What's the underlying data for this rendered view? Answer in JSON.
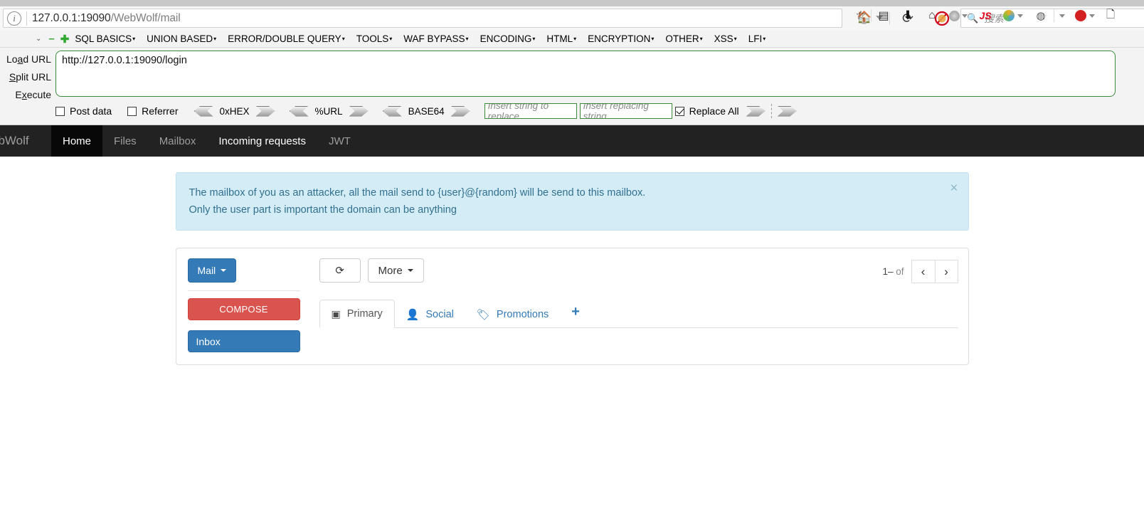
{
  "browser": {
    "url_main": "127.0.0.1:19090",
    "url_path": "/WebWolf/mail",
    "search_placeholder": "搜索",
    "icons": {
      "info": "info-icon",
      "home": "home-icon",
      "reload": "reload-icon",
      "noscript": "noscript-icon",
      "search": "search-icon",
      "bookmark": "star-icon",
      "library": "library-icon",
      "downloads": "download-icon",
      "home2": "home-icon",
      "account": "account-icon",
      "js": "JS",
      "sync": "sync-icon",
      "palette": "palette-icon",
      "extension": "extension-icon",
      "pocket": "page-icon"
    }
  },
  "hackbar": {
    "menu_items": [
      {
        "label": "SQL BASICS",
        "caret": "▾"
      },
      {
        "label": "UNION BASED",
        "caret": "▾"
      },
      {
        "label": "ERROR/DOUBLE QUERY",
        "caret": "▾"
      },
      {
        "label": "TOOLS",
        "caret": "▾"
      },
      {
        "label": "WAF BYPASS",
        "caret": "▾"
      },
      {
        "label": "ENCODING",
        "caret": "▾"
      },
      {
        "label": "HTML",
        "caret": "▾"
      },
      {
        "label": "ENCRYPTION",
        "caret": "▾"
      },
      {
        "label": "OTHER",
        "caret": "▾"
      },
      {
        "label": "XSS",
        "caret": "▾"
      },
      {
        "label": "LFI",
        "caret": "▾"
      }
    ],
    "minus_label": "–",
    "plus_label": "✚",
    "actions": [
      {
        "pre": "Lo",
        "key": "a",
        "post": "d URL"
      },
      {
        "pre": "",
        "key": "S",
        "post": "plit URL"
      },
      {
        "pre": "E",
        "key": "x",
        "post": "ecute"
      }
    ],
    "url_value": "http://127.0.0.1:19090/login",
    "post_data_label": "Post data",
    "referrer_label": "Referrer",
    "encoders": [
      "0xHEX",
      "%URL",
      "BASE64"
    ],
    "replace_find_placeholder": "Insert string to replace",
    "replace_with_placeholder": "Insert replacing string",
    "replace_all_label": "Replace All"
  },
  "webwolf": {
    "brand": "ebWolf",
    "nav": [
      {
        "label": "Home",
        "state": "active"
      },
      {
        "label": "Files",
        "state": "dim"
      },
      {
        "label": "Mailbox",
        "state": "dim"
      },
      {
        "label": "Incoming requests",
        "state": "bright"
      },
      {
        "label": "JWT",
        "state": "dim"
      }
    ]
  },
  "alert": {
    "line1": "The mailbox of you as an attacker, all the mail send to {user}@{random} will be send to this mailbox.",
    "line2": "Only the user part is important the domain can be anything",
    "close": "×",
    "bg_color": "#d4ecf6",
    "text_color": "#31708f"
  },
  "mail": {
    "dropdown_label": "Mail",
    "compose_label": "COMPOSE",
    "inbox_label": "Inbox",
    "refresh_icon": "refresh-icon",
    "more_label": "More",
    "pager": {
      "range": "1–",
      "of": "of",
      "prev": "‹",
      "next": "›"
    },
    "tabs": [
      {
        "label": "Primary",
        "icon": "inbox-icon",
        "active": true
      },
      {
        "label": "Social",
        "icon": "person-icon",
        "active": false
      },
      {
        "label": "Promotions",
        "icon": "tag-icon",
        "active": false
      }
    ],
    "add_tab": "+",
    "colors": {
      "primary_blue": "#337ab7",
      "compose_red": "#d9534f"
    }
  }
}
